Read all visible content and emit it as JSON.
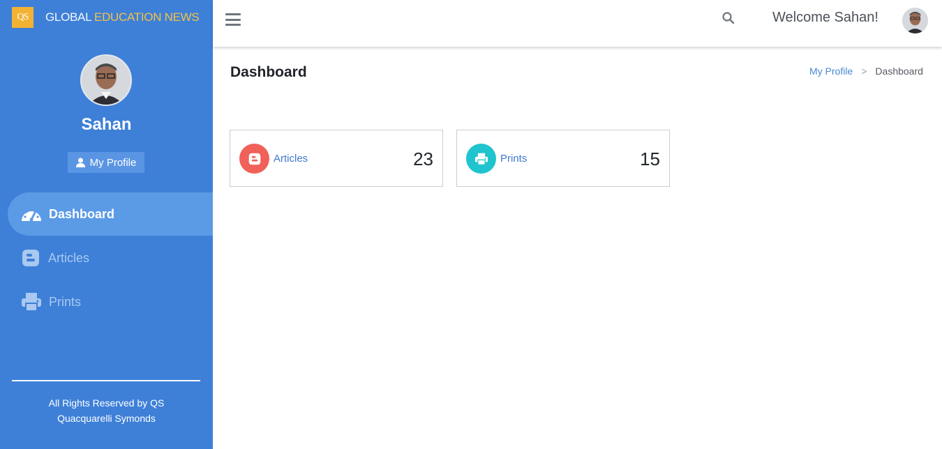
{
  "brand": {
    "logo": "QS",
    "name_part1": "GLOBAL ",
    "name_part2": "EDUCATION NEWS"
  },
  "sidebar": {
    "user_name": "Sahan",
    "profile_button": "My Profile",
    "nav": [
      {
        "label": "Dashboard",
        "icon": "tachometer-icon",
        "active": true
      },
      {
        "label": "Articles",
        "icon": "blogger-icon",
        "active": false
      },
      {
        "label": "Prints",
        "icon": "printer-icon",
        "active": false
      }
    ],
    "footer_line1": "All Rights Reserved by QS",
    "footer_line2": "Quacquarelli Symonds"
  },
  "header": {
    "welcome": "Welcome Sahan!"
  },
  "page": {
    "title": "Dashboard",
    "breadcrumb": {
      "parent": "My Profile",
      "separator": ">",
      "current": "Dashboard"
    }
  },
  "cards": [
    {
      "label": "Articles",
      "value": "23",
      "color": "#f0615a",
      "icon": "blogger-icon"
    },
    {
      "label": "Prints",
      "value": "15",
      "color": "#1fc4cf",
      "icon": "printer-icon"
    }
  ],
  "colors": {
    "sidebar": "#3e80d8",
    "active_nav": "#5b9be6",
    "brand_accent": "#f2b233"
  }
}
